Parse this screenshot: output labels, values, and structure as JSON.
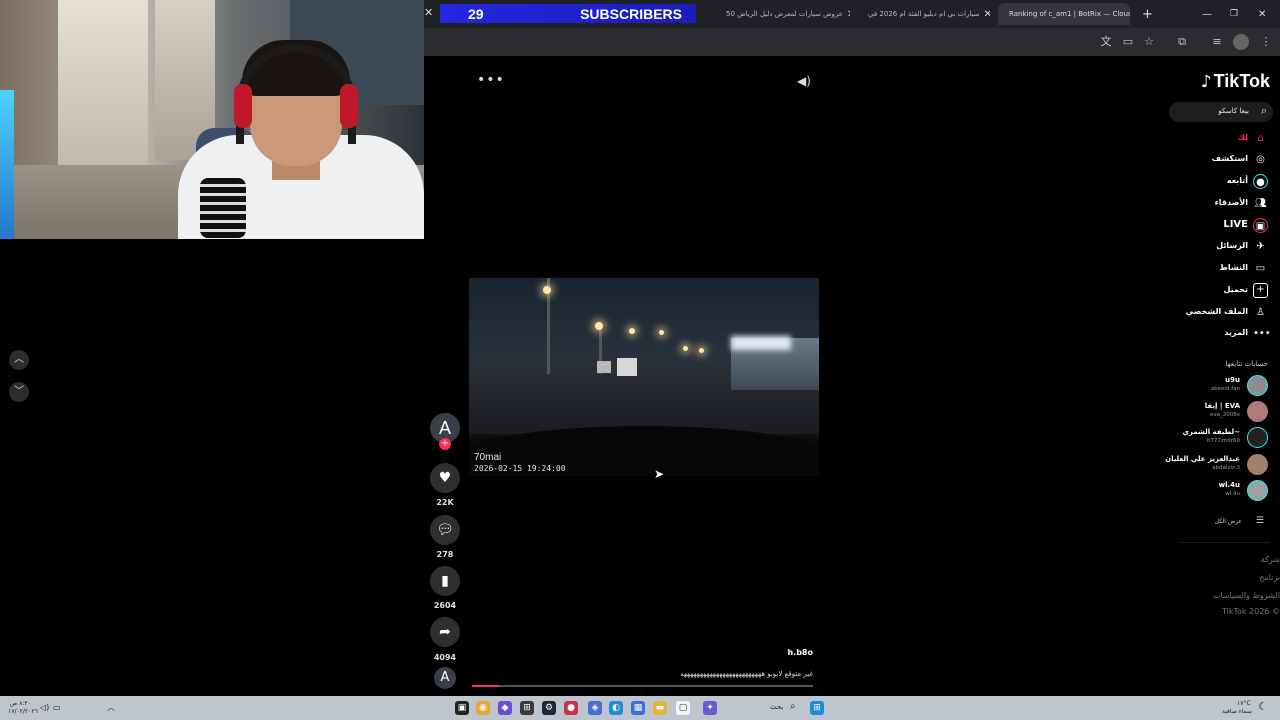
{
  "stream_overlay": {
    "subscriber_count": "29",
    "subscriber_label": "SUBSCRIBERS"
  },
  "browser": {
    "tabs": [
      {
        "title": "50 عروض سيارات لمعرض دليل الرياض"
      },
      {
        "title": "سيارات بي ام دبليو الفئة ام 2026 في"
      },
      {
        "title": "Ranking of c_am1 | BotRix — Cloud"
      }
    ],
    "new_tab_label": "+",
    "toolbar_icons": [
      "translate-icon",
      "cast-icon",
      "star-icon",
      "extensions-icon",
      "queue-icon",
      "profile-icon",
      "menu-icon"
    ]
  },
  "tiktok": {
    "logo": "TikTok",
    "search": {
      "text": "بيغا كاسكو"
    },
    "nav": [
      {
        "label": "لك",
        "icon": "home-icon",
        "active": true
      },
      {
        "label": "استكشف",
        "icon": "compass-icon",
        "active": false
      },
      {
        "label": "أتابعه",
        "icon": "following-icon",
        "active": false
      },
      {
        "label": "الأصدقاء",
        "icon": "friends-icon",
        "active": false
      },
      {
        "label": "LIVE",
        "icon": "live-icon",
        "active": false
      },
      {
        "label": "الرسائل",
        "icon": "messages-icon",
        "active": false
      },
      {
        "label": "النشاط",
        "icon": "activity-icon",
        "active": false
      },
      {
        "label": "تحميل",
        "icon": "upload-icon",
        "active": false
      },
      {
        "label": "الملف الشخصي",
        "icon": "profile-icon",
        "active": false
      },
      {
        "label": "المزيد",
        "icon": "more-icon",
        "active": false
      }
    ],
    "following_title": "حسابات تتابعها",
    "following_accounts": [
      {
        "name": "u9u",
        "handle": "abeeld.fan"
      },
      {
        "name": "إيفا | EVA",
        "handle": "eva_2008x"
      },
      {
        "name": "لطيفه الشمري~",
        "handle": "lt777zndr60"
      },
      {
        "name": "عبدالعزيز علي العليان",
        "handle": "abdalziz.3"
      },
      {
        "name": "wl.4u",
        "handle": "wl.4u"
      }
    ],
    "see_all": "عرض الكل",
    "footer_links": [
      "شركة",
      "برنامج",
      "الشروط والسياسات",
      "TikTok 2026 ©"
    ],
    "video": {
      "camera_brand": "70mai",
      "camera_timestamp": "2026-02-15  19:24:00",
      "author": "h.b8o",
      "caption": "غير متوقع لابوبو هههههههههههههههههههههههههه",
      "progress_fraction": 0.08
    },
    "actions": {
      "creator_initial": "A",
      "follow_symbol": "+",
      "likes": "22K",
      "comments": "278",
      "saves": "2604",
      "shares": "4094",
      "music_initial": "A"
    }
  },
  "taskbar": {
    "weather_temp": "١٧°C",
    "weather_desc": "سماء صافية",
    "search_placeholder": "بحث",
    "clock_time": "٨:٣٠ ص",
    "clock_date": "١٧/٠٢/٢٠٢٦"
  },
  "colors": {
    "tiktok_red": "#fe2c55",
    "tiktok_cyan": "#25f4ee",
    "overlay_blue": "#2327e0",
    "browser_bg": "#202124"
  }
}
